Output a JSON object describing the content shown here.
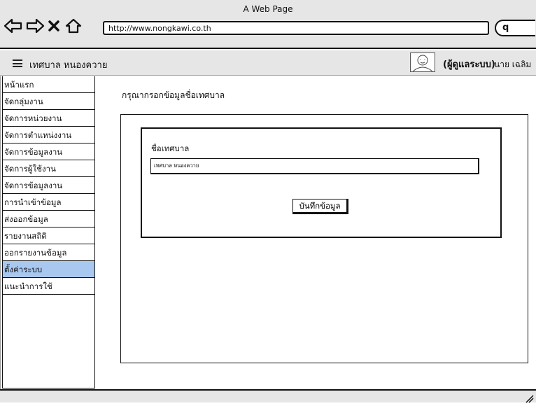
{
  "browser": {
    "page_title": "A Web Page",
    "url": "http://www.nongkawi.co.th",
    "icons": [
      "back-arrow-icon",
      "forward-arrow-icon",
      "close-icon",
      "home-icon",
      "search-icon"
    ]
  },
  "header": {
    "menu_icon": "hamburger-menu-icon",
    "title": "เทศบาล  หนองควาย",
    "user_role": "(ผู้ดูแลระบบ)",
    "user_name": "นาย เฉลิม",
    "avatar_icon": "user-avatar-icon"
  },
  "sidebar": {
    "items": [
      {
        "label": "หน้าแรก",
        "active": false
      },
      {
        "label": "จัดกลุ่มงาน",
        "active": false
      },
      {
        "label": "จัดการหน่วยงาน",
        "active": false
      },
      {
        "label": "จัดการตำแหน่งงาน",
        "active": false
      },
      {
        "label": "จัดการข้อมูลงาน",
        "active": false
      },
      {
        "label": "จัดการผู้ใช้งาน",
        "active": false
      },
      {
        "label": "จัดการข้อมูลงาน",
        "active": false
      },
      {
        "label": "การนำเข้าข้อมูล",
        "active": false
      },
      {
        "label": "ส่งออกข้อมูล",
        "active": false
      },
      {
        "label": "รายงานสถิติ",
        "active": false
      },
      {
        "label": "ออกรายงานข้อมูล",
        "active": false
      },
      {
        "label": "ตั้งค่าระบบ",
        "active": true
      },
      {
        "label": "แนะนำการใช้",
        "active": false
      }
    ],
    "active_color": "#a8c8f0"
  },
  "main": {
    "prompt": "กรุณากรอกข้อมูลชื่อเทศบาล",
    "form": {
      "field_label": "ชื่อเทศบาล",
      "field_value": "เทศบาล หนองควาย",
      "save_label": "บันทึกข้อมูล"
    }
  }
}
